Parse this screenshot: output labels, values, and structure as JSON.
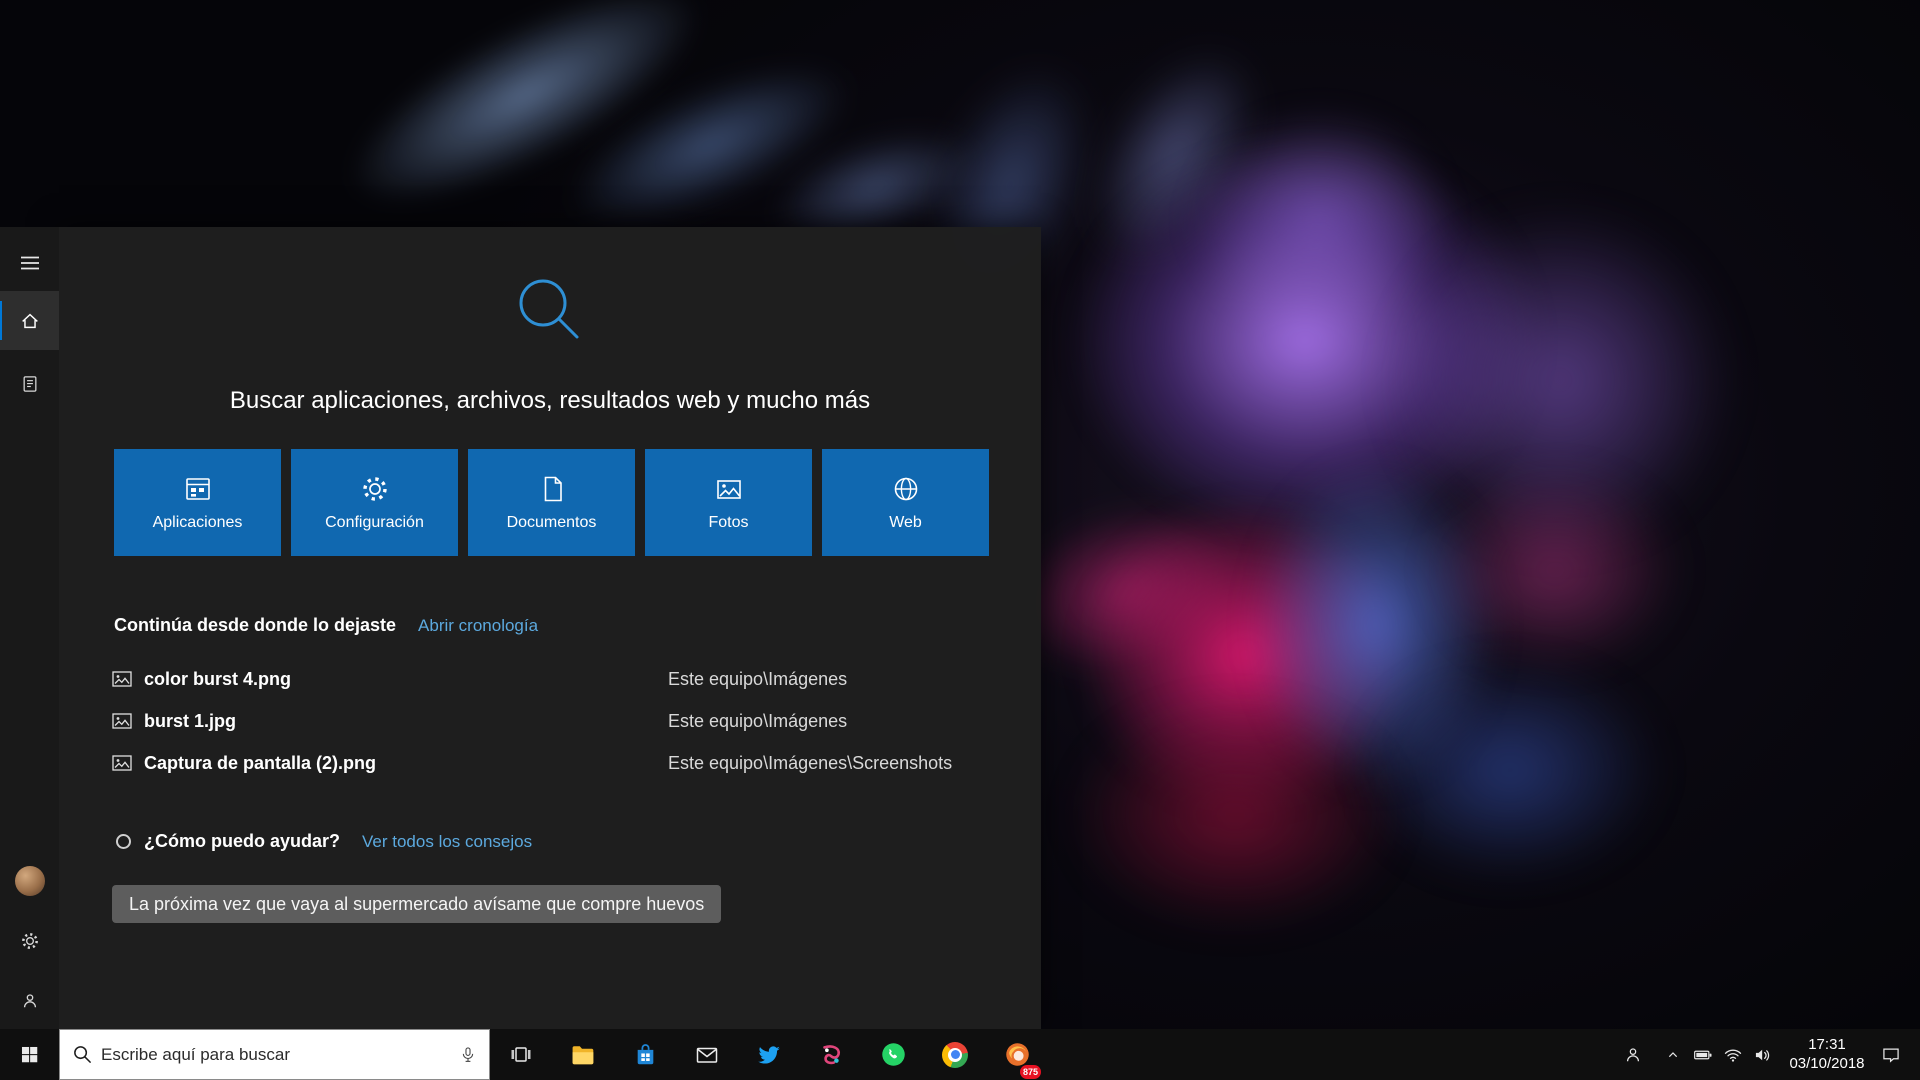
{
  "search_panel": {
    "heading": "Buscar aplicaciones, archivos, resultados web y mucho más",
    "tiles": [
      {
        "label": "Aplicaciones",
        "icon": "apps-icon"
      },
      {
        "label": "Configuración",
        "icon": "gear-icon"
      },
      {
        "label": "Documentos",
        "icon": "document-icon"
      },
      {
        "label": "Fotos",
        "icon": "photos-icon"
      },
      {
        "label": "Web",
        "icon": "globe-icon"
      }
    ],
    "continue": {
      "title": "Continúa desde donde lo dejaste",
      "link": "Abrir cronología",
      "files": [
        {
          "name": "color burst 4.png",
          "location": "Este equipo\\Imágenes",
          "icon": "image-file-icon"
        },
        {
          "name": "burst 1.jpg",
          "location": "Este equipo\\Imágenes",
          "icon": "image-file-icon"
        },
        {
          "name": "Captura de pantalla (2).png",
          "location": "Este equipo\\Imágenes\\Screenshots",
          "icon": "image-file-icon"
        }
      ]
    },
    "help": {
      "title": "¿Cómo puedo ayudar?",
      "link": "Ver todos los consejos",
      "suggestion": "La próxima vez que vaya al supermercado avísame que compre huevos"
    }
  },
  "sidebar": {
    "items": [
      "menu",
      "home",
      "notebook"
    ],
    "selected": "home",
    "bottom": [
      "user-avatar",
      "settings",
      "feedback"
    ]
  },
  "taskbar": {
    "search": {
      "placeholder": "Escribe aquí para buscar"
    },
    "apps": [
      "task-view",
      "file-explorer",
      "microsoft-store",
      "mail",
      "twitter",
      "paint-3d",
      "whatsapp",
      "chrome",
      "browser-orange"
    ],
    "app_badge": {
      "app": "browser-orange",
      "value": "875"
    },
    "clock": {
      "time": "17:31",
      "date": "03/10/2018"
    }
  },
  "colors": {
    "tile_blue": "#1068b0",
    "link_blue": "#5ca9de",
    "accent": "#0078d7",
    "badge_red": "#e81123",
    "search_glyph": "#2e8fd4"
  }
}
